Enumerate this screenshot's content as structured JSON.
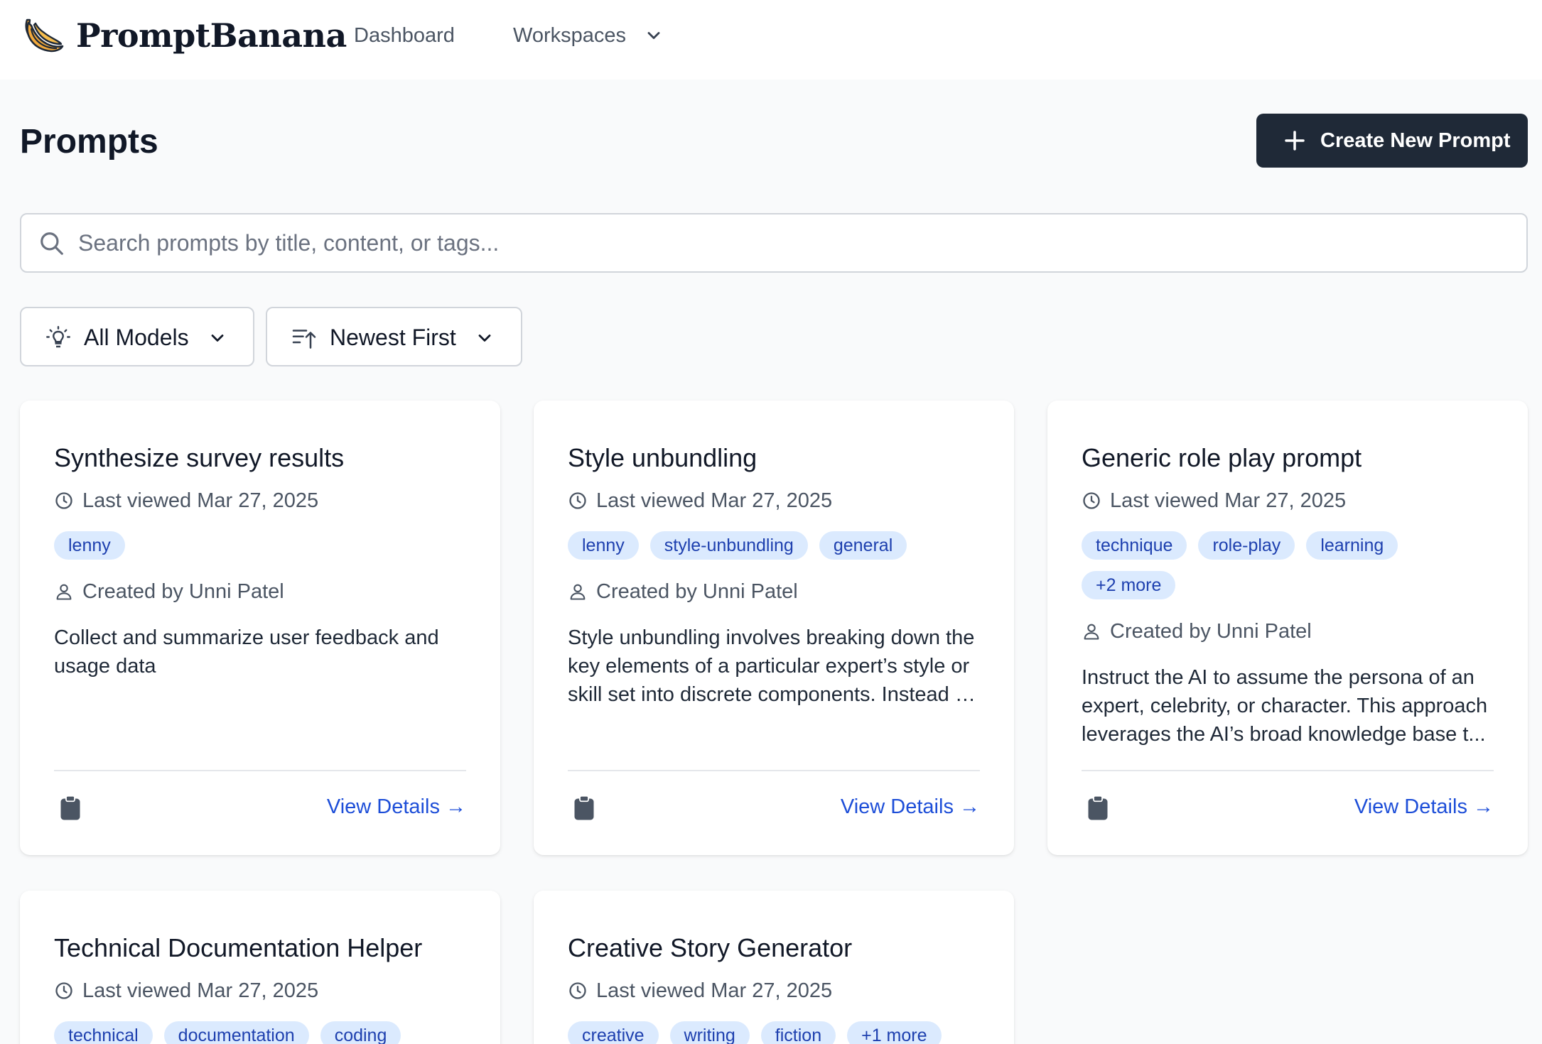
{
  "brand": {
    "name": "PromptBanana"
  },
  "nav": {
    "dashboard": "Dashboard",
    "workspaces": "Workspaces"
  },
  "page": {
    "title": "Prompts",
    "create_label": "Create New Prompt"
  },
  "search": {
    "placeholder": "Search prompts by title, content, or tags..."
  },
  "filters": {
    "model": "All Models",
    "sort": "Newest First"
  },
  "cards": [
    {
      "title": "Synthesize survey results",
      "last_viewed": "Last viewed Mar 27, 2025",
      "tags": [
        "lenny"
      ],
      "created_by": "Created by Unni Patel",
      "desc_lines": [
        "Collect and summarize user feedback and",
        "usage data"
      ],
      "view": "View Details →"
    },
    {
      "title": "Style unbundling",
      "last_viewed": "Last viewed Mar 27, 2025",
      "tags": [
        "lenny",
        "style-unbundling",
        "general"
      ],
      "created_by": "Created by Unni Patel",
      "desc_lines": [
        "Style unbundling involves breaking down the",
        "key elements of a particular expert’s style or",
        "skill set into discrete components. Instead …"
      ],
      "view": "View Details →"
    },
    {
      "title": "Generic role play prompt",
      "last_viewed": "Last viewed Mar 27, 2025",
      "tags": [
        "technique",
        "role-play",
        "learning",
        "+2 more"
      ],
      "created_by": "Created by Unni Patel",
      "desc_lines": [
        "Instruct the AI to assume the persona of an",
        "expert, celebrity, or character. This approach",
        "leverages the AI’s broad knowledge base t..."
      ],
      "view": "View Details →"
    },
    {
      "title": "Technical Documentation Helper",
      "last_viewed": "Last viewed Mar 27, 2025",
      "tags": [
        "technical",
        "documentation",
        "coding"
      ]
    },
    {
      "title": "Creative Story Generator",
      "last_viewed": "Last viewed Mar 27, 2025",
      "tags": [
        "creative",
        "writing",
        "fiction",
        "+1 more"
      ]
    }
  ]
}
